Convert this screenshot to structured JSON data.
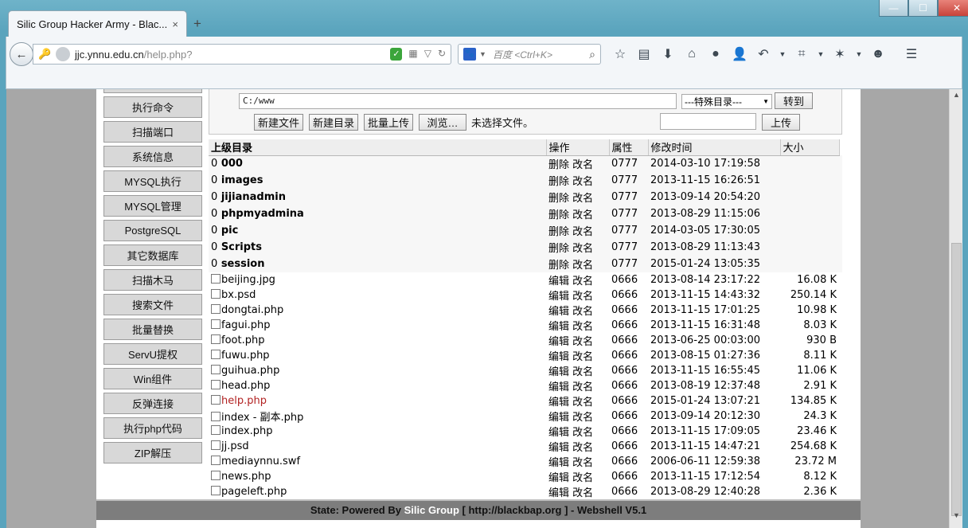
{
  "window": {
    "minimize": "—",
    "maximize": "☐",
    "close": "✕"
  },
  "tab": {
    "title": "Silic Group Hacker Army - Blac...",
    "close": "×",
    "new": "+"
  },
  "urlbar": {
    "domain": "jjc.ynnu.edu.cn",
    "path": "/help.php?"
  },
  "search": {
    "placeholder": "百度 <Ctrl+K>"
  },
  "sidebar": {
    "items": [
      "执行命令",
      "扫描端口",
      "系统信息",
      "MYSQL执行",
      "MYSQL管理",
      "PostgreSQL",
      "其它数据库",
      "扫描木马",
      "搜索文件",
      "批量替换",
      "ServU提权",
      "Win组件",
      "反弹连接",
      "执行php代码",
      "ZIP解压"
    ]
  },
  "toolbox": {
    "path_value": "C:/www",
    "special_dir": "---特殊目录---",
    "goto": "转到",
    "new_file": "新建文件",
    "new_dir": "新建目录",
    "batch_upload": "批量上传",
    "browse": "浏览…",
    "no_file": "未选择文件。",
    "upload": "上传"
  },
  "table": {
    "headers": {
      "name": "上级目录",
      "action": "操作",
      "attr": "属性",
      "mtime": "修改时间",
      "size": "大小"
    },
    "dirs": [
      {
        "prefix": "0",
        "name": "000",
        "a1": "删除",
        "a2": "改名",
        "attr": "0777",
        "mtime": "2014-03-10 17:19:58"
      },
      {
        "prefix": "0",
        "name": "images",
        "a1": "删除",
        "a2": "改名",
        "attr": "0777",
        "mtime": "2013-11-15 16:26:51"
      },
      {
        "prefix": "0",
        "name": "jijianadmin",
        "a1": "删除",
        "a2": "改名",
        "attr": "0777",
        "mtime": "2013-09-14 20:54:20"
      },
      {
        "prefix": "0",
        "name": "phpmyadmina",
        "a1": "删除",
        "a2": "改名",
        "attr": "0777",
        "mtime": "2013-08-29 11:15:06"
      },
      {
        "prefix": "0",
        "name": "pic",
        "a1": "删除",
        "a2": "改名",
        "attr": "0777",
        "mtime": "2014-03-05 17:30:05"
      },
      {
        "prefix": "0",
        "name": "Scripts",
        "a1": "删除",
        "a2": "改名",
        "attr": "0777",
        "mtime": "2013-08-29 11:13:43"
      },
      {
        "prefix": "0",
        "name": "session",
        "a1": "删除",
        "a2": "改名",
        "attr": "0777",
        "mtime": "2015-01-24 13:05:35"
      }
    ],
    "files": [
      {
        "name": "beijing.jpg",
        "a1": "编辑",
        "a2": "改名",
        "attr": "0666",
        "mtime": "2013-08-14 23:17:22",
        "size": "16.08 K"
      },
      {
        "name": "bx.psd",
        "a1": "编辑",
        "a2": "改名",
        "attr": "0666",
        "mtime": "2013-11-15 14:43:32",
        "size": "250.14 K"
      },
      {
        "name": "dongtai.php",
        "a1": "编辑",
        "a2": "改名",
        "attr": "0666",
        "mtime": "2013-11-15 17:01:25",
        "size": "10.98 K"
      },
      {
        "name": "fagui.php",
        "a1": "编辑",
        "a2": "改名",
        "attr": "0666",
        "mtime": "2013-11-15 16:31:48",
        "size": "8.03 K"
      },
      {
        "name": "foot.php",
        "a1": "编辑",
        "a2": "改名",
        "attr": "0666",
        "mtime": "2013-06-25 00:03:00",
        "size": "930 B"
      },
      {
        "name": "fuwu.php",
        "a1": "编辑",
        "a2": "改名",
        "attr": "0666",
        "mtime": "2013-08-15 01:27:36",
        "size": "8.11 K"
      },
      {
        "name": "guihua.php",
        "a1": "编辑",
        "a2": "改名",
        "attr": "0666",
        "mtime": "2013-11-15 16:55:45",
        "size": "11.06 K"
      },
      {
        "name": "head.php",
        "a1": "编辑",
        "a2": "改名",
        "attr": "0666",
        "mtime": "2013-08-19 12:37:48",
        "size": "2.91 K"
      },
      {
        "name": "help.php",
        "a1": "编辑",
        "a2": "改名",
        "attr": "0666",
        "mtime": "2015-01-24 13:07:21",
        "size": "134.85 K",
        "highlight": true
      },
      {
        "name": "index - 副本.php",
        "a1": "编辑",
        "a2": "改名",
        "attr": "0666",
        "mtime": "2013-09-14 20:12:30",
        "size": "24.3 K"
      },
      {
        "name": "index.php",
        "a1": "编辑",
        "a2": "改名",
        "attr": "0666",
        "mtime": "2013-11-15 17:09:05",
        "size": "23.46 K"
      },
      {
        "name": "jj.psd",
        "a1": "编辑",
        "a2": "改名",
        "attr": "0666",
        "mtime": "2013-11-15 14:47:21",
        "size": "254.68 K"
      },
      {
        "name": "mediaynnu.swf",
        "a1": "编辑",
        "a2": "改名",
        "attr": "0666",
        "mtime": "2006-06-11 12:59:38",
        "size": "23.72 M"
      },
      {
        "name": "news.php",
        "a1": "编辑",
        "a2": "改名",
        "attr": "0666",
        "mtime": "2013-11-15 17:12:54",
        "size": "8.12 K"
      },
      {
        "name": "pageleft.php",
        "a1": "编辑",
        "a2": "改名",
        "attr": "0666",
        "mtime": "2013-08-29 12:40:28",
        "size": "2.36 K"
      }
    ]
  },
  "footer": {
    "pre": "State: Powered By ",
    "brand": "Silic Group",
    "post": " [ http://blackbap.org ] - Webshell V5.1"
  },
  "colors": {
    "highlight_file": "#b22222",
    "footer_bg": "#7d7d7d",
    "nav_bg": "#d8d8d8"
  }
}
